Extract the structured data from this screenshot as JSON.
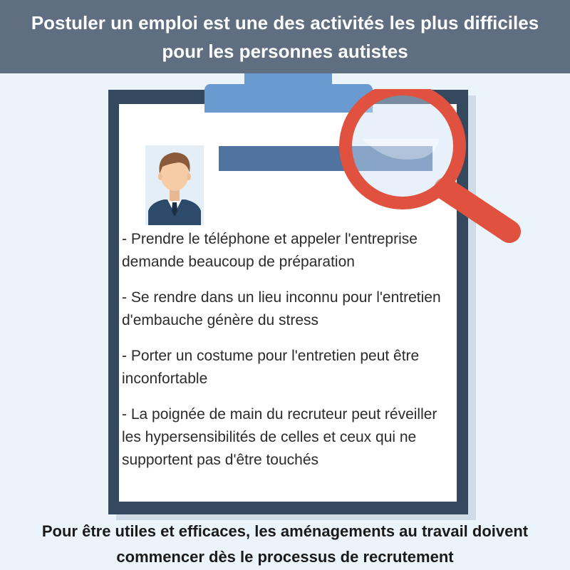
{
  "header": {
    "line1": "Postuler un emploi est une des activités les plus difficiles",
    "line2": "pour les personnes autistes"
  },
  "items": [
    {
      "text": "- Prendre le téléphone et appeler l'entreprise demande beaucoup de préparation"
    },
    {
      "text": "- Se rendre dans un lieu inconnu pour l'entretien d'embauche génère du stress"
    },
    {
      "text": "- Porter un costume pour l'entretien peut être inconfortable"
    },
    {
      "text": "- La poignée de main du recruteur peut réveiller les hypersensibilités de celles et ceux qui ne supportent pas d'être touchés"
    }
  ],
  "footer": {
    "line1": "Pour être utiles et efficaces, les aménagements au travail doivent",
    "line2": "commencer dès le processus de recrutement"
  },
  "icons": {
    "photo": "person-avatar-icon",
    "magnifier": "magnifying-glass-icon",
    "clipboard": "clipboard-icon"
  },
  "colors": {
    "header_bg": "#5f6e80",
    "background": "#ecf4fb",
    "board": "#34485e",
    "clip": "#6a9bd0",
    "name_bar": "#5173a0",
    "magnifier": "#e0523f"
  }
}
